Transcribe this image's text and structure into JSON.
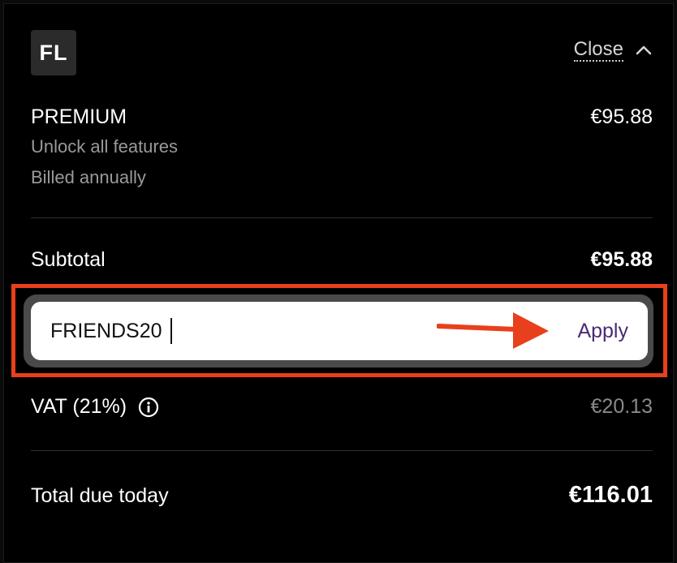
{
  "header": {
    "logo_text": "FL",
    "close_label": "Close",
    "close_icon": "chevron-up-icon"
  },
  "plan": {
    "name": "PREMIUM",
    "price": "€95.88",
    "description": "Unlock all features",
    "billing": "Billed annually"
  },
  "subtotal": {
    "label": "Subtotal",
    "value": "€95.88"
  },
  "promo": {
    "value": "FRIENDS20",
    "apply_label": "Apply",
    "annotation": "red-arrow-icon"
  },
  "vat": {
    "label": "VAT (21%)",
    "info_icon": "info-icon",
    "value": "€20.13"
  },
  "total": {
    "label": "Total due today",
    "value": "€116.01"
  },
  "colors": {
    "background": "#000000",
    "highlight": "#e8401c",
    "apply_text": "#4a2a74",
    "muted_text": "#9a9a9a"
  }
}
